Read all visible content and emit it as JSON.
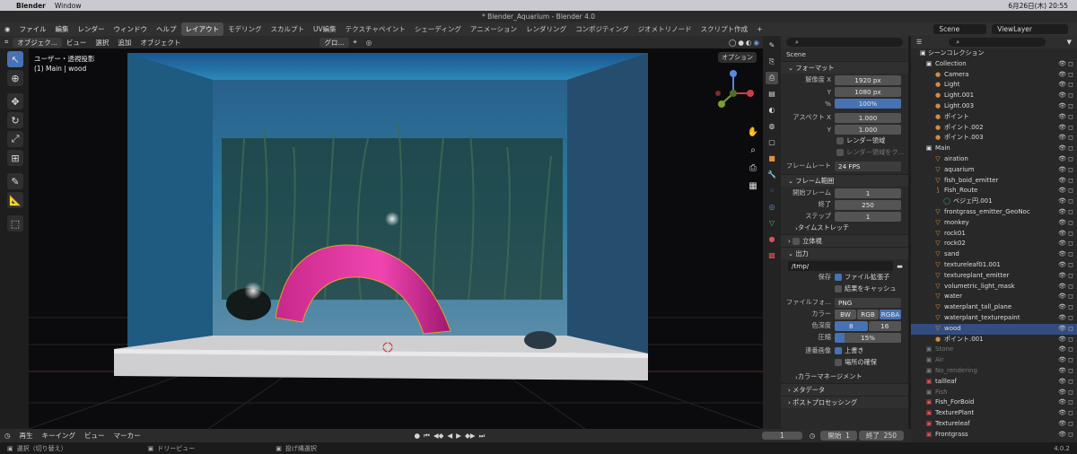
{
  "mac": {
    "app": "Blender",
    "menu": "Window",
    "date": "6月26日(木) 20:55"
  },
  "window_title": "* Blender_Aquarium - Blender 4.0",
  "menus": [
    "ファイル",
    "編集",
    "レンダー",
    "ウィンドウ",
    "ヘルプ"
  ],
  "workspaces": [
    "レイアウト",
    "モデリング",
    "スカルプト",
    "UV編集",
    "テクスチャペイント",
    "シェーディング",
    "アニメーション",
    "レンダリング",
    "コンポジティング",
    "ジオメトリノード",
    "スクリプト作成"
  ],
  "scene_name": "Scene",
  "viewlayer": "ViewLayer",
  "vp_header": {
    "mode": "オブジェク...",
    "items": [
      "ビュー",
      "選択",
      "追加",
      "オブジェクト"
    ],
    "transform": "グロ...",
    "options": "オプション"
  },
  "vp_label": {
    "line1": "ユーザー・透視投影",
    "line2": "(1) Main | wood"
  },
  "props": {
    "scene": "Scene",
    "format": "フォーマット",
    "resx_lbl": "解像度 X",
    "resx": "1920 px",
    "resy_lbl": "Y",
    "resy": "1080 px",
    "pct_lbl": "%",
    "pct": "100%",
    "aspx_lbl": "アスペクト X",
    "aspx": "1.000",
    "aspy_lbl": "Y",
    "aspy": "1.000",
    "region": "レンダー領域",
    "crop": "レンダー領域をク...",
    "fps_lbl": "フレームレート",
    "fps": "24 FPS",
    "frange": "フレーム範囲",
    "fstart_lbl": "開始フレーム",
    "fstart": "1",
    "fend_lbl": "終了",
    "fend": "250",
    "fstep_lbl": "ステップ",
    "fstep": "1",
    "stretch": "タイムストレッチ",
    "stereo": "立体視",
    "output": "出力",
    "path": "/tmp/",
    "save_lbl": "保存",
    "ext": "ファイル拡張子",
    "cache": "結果をキャッシュ",
    "ff_lbl": "ファイルフォ...",
    "ff": "PNG",
    "color_lbl": "カラー",
    "bw": "BW",
    "rgb": "RGB",
    "rgba": "RGBA",
    "depth_lbl": "色深度",
    "d8": "8",
    "d16": "16",
    "comp_lbl": "圧縮",
    "comp": "15%",
    "seq_lbl": "連番画像",
    "overwrite": "上書き",
    "placeholder": "場所の確保",
    "cm": "カラーマネージメント",
    "meta": "メタデータ",
    "post": "ポストプロセッシング"
  },
  "outliner": {
    "title": "シーンコレクション",
    "rows": [
      {
        "n": "Collection",
        "d": 1,
        "i": "▣",
        "c": "#ddd"
      },
      {
        "n": "Camera",
        "d": 2,
        "i": "●",
        "c": "#d08a4a"
      },
      {
        "n": "Light",
        "d": 2,
        "i": "●",
        "c": "#d08a4a"
      },
      {
        "n": "Light.001",
        "d": 2,
        "i": "●",
        "c": "#d08a4a"
      },
      {
        "n": "Light.003",
        "d": 2,
        "i": "●",
        "c": "#d08a4a"
      },
      {
        "n": "ポイント",
        "d": 2,
        "i": "●",
        "c": "#d08a4a"
      },
      {
        "n": "ポイント.002",
        "d": 2,
        "i": "●",
        "c": "#d08a4a"
      },
      {
        "n": "ポイント.003",
        "d": 2,
        "i": "●",
        "c": "#d08a4a"
      },
      {
        "n": "Main",
        "d": 1,
        "i": "▣",
        "c": "#ddd"
      },
      {
        "n": "airation",
        "d": 2,
        "i": "▽",
        "c": "#e09040"
      },
      {
        "n": "aquarium",
        "d": 2,
        "i": "▽",
        "c": "#e09040"
      },
      {
        "n": "fish_boid_emitter",
        "d": 2,
        "i": "▽",
        "c": "#e09040"
      },
      {
        "n": "Fish_Route",
        "d": 2,
        "i": "⟆",
        "c": "#e09040"
      },
      {
        "n": "ベジェ円.001",
        "d": 3,
        "i": "◯",
        "c": "#49b46d"
      },
      {
        "n": "frontgrass_emitter_GeoNoc",
        "d": 2,
        "i": "▽",
        "c": "#e09040"
      },
      {
        "n": "monkey",
        "d": 2,
        "i": "▽",
        "c": "#e09040"
      },
      {
        "n": "rock01",
        "d": 2,
        "i": "▽",
        "c": "#e09040"
      },
      {
        "n": "rock02",
        "d": 2,
        "i": "▽",
        "c": "#e09040"
      },
      {
        "n": "sand",
        "d": 2,
        "i": "▽",
        "c": "#e09040"
      },
      {
        "n": "textureleaf01.001",
        "d": 2,
        "i": "▽",
        "c": "#e09040"
      },
      {
        "n": "textureplant_emitter",
        "d": 2,
        "i": "▽",
        "c": "#e09040"
      },
      {
        "n": "volumetric_light_mask",
        "d": 2,
        "i": "▽",
        "c": "#e09040"
      },
      {
        "n": "water",
        "d": 2,
        "i": "▽",
        "c": "#e09040"
      },
      {
        "n": "waterplant_tall_plane",
        "d": 2,
        "i": "▽",
        "c": "#e09040"
      },
      {
        "n": "waterplant_texturepaint",
        "d": 2,
        "i": "▽",
        "c": "#e09040"
      },
      {
        "n": "wood",
        "d": 2,
        "i": "▽",
        "c": "#e09040",
        "sel": true
      },
      {
        "n": "ポイント.001",
        "d": 2,
        "i": "●",
        "c": "#d08a4a"
      },
      {
        "n": "Stone",
        "d": 1,
        "i": "▣",
        "c": "#777",
        "dim": true
      },
      {
        "n": "Air",
        "d": 1,
        "i": "▣",
        "c": "#777",
        "dim": true
      },
      {
        "n": "No_rendering",
        "d": 1,
        "i": "▣",
        "c": "#777",
        "dim": true
      },
      {
        "n": "tallleaf",
        "d": 1,
        "i": "▣",
        "c": "#e05050"
      },
      {
        "n": "Fish",
        "d": 1,
        "i": "▣",
        "c": "#777",
        "dim": true
      },
      {
        "n": "Fish_ForBoid",
        "d": 1,
        "i": "▣",
        "c": "#e05050"
      },
      {
        "n": "TexturePlant",
        "d": 1,
        "i": "▣",
        "c": "#e05050"
      },
      {
        "n": "Textureleaf",
        "d": 1,
        "i": "▣",
        "c": "#e05050"
      },
      {
        "n": "Frontgrass",
        "d": 1,
        "i": "▣",
        "c": "#e05050"
      }
    ]
  },
  "timeline": {
    "items": [
      "再生",
      "キーイング",
      "ビュー",
      "マーカー"
    ],
    "frame": "1",
    "start_lbl": "開始",
    "start": "1",
    "end_lbl": "終了",
    "end": "250"
  },
  "status": {
    "s1": "選択（切り替え）",
    "s2": "ドリービュー",
    "s3": "投げ縄選択",
    "version": "4.0.2"
  }
}
